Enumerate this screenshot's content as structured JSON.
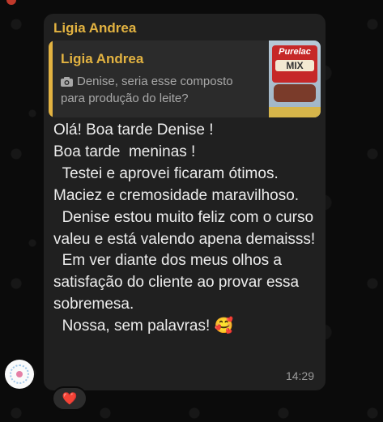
{
  "message": {
    "sender": "Ligia Andrea",
    "quoted": {
      "name": "Ligia Andrea",
      "type_icon": "camera-icon",
      "text": "Denise, seria esse composto para produção do leite?",
      "thumbnail": {
        "brand": "Purelac",
        "label": "MIX"
      }
    },
    "text": "Olá! Boa tarde Denise !\nBoa tarde  meninas !\n  Testei e aprovei ficaram ótimos. Maciez e cremosidade maravilhoso.\n  Denise estou muito feliz com o curso valeu e está valendo apena demaisss!\n  Em ver diante dos meus olhos a satisfação do cliente ao provar essa sobremesa.\n  Nossa, sem palavras! 🥰",
    "time": "14:29",
    "reaction": "❤️"
  },
  "colors": {
    "accent": "#e3b341",
    "bubble": "#202020",
    "background": "#0b0b0b"
  }
}
